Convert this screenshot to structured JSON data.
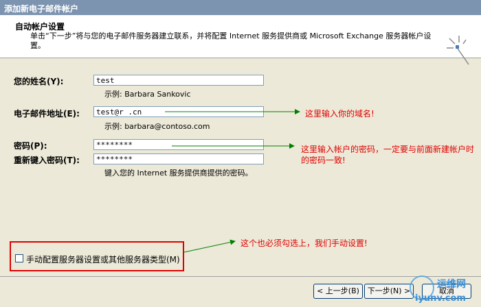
{
  "window": {
    "title": "添加新电子邮件帐户"
  },
  "header": {
    "title": "自动帐户设置",
    "description": "单击“下一步”将与您的电子邮件服务器建立联系，并将配置 Internet 服务提供商或 Microsoft Exchange 服务器帐户设置。"
  },
  "form": {
    "name_label": "您的姓名(Y):",
    "name_value": "test",
    "name_hint": "示例: Barbara Sankovic",
    "email_label": "电子邮件地址(E):",
    "email_value": "test@r      .cn",
    "email_hint": "示例: barbara@contoso.com",
    "password_label": "密码(P):",
    "password_value": "********",
    "retype_label": "重新键入密码(T):",
    "retype_value": "********",
    "password_hint": "键入您的 Internet 服务提供商提供的密码。",
    "manual_label": "手动配置服务器设置或其他服务器类型(M)",
    "manual_checked": false
  },
  "annotations": {
    "domain_note": "这里输入你的域名!",
    "password_note": "这里输入帐户的密码，一定要与前面新建帐户时的密码一致!",
    "manual_note": "这个也必须勾选上，我们手动设置!",
    "color": "#e00000",
    "arrow_color": "#008000"
  },
  "buttons": {
    "back": "< 上一步(B)",
    "next": "下一步(N) >",
    "cancel": "取消"
  },
  "watermark": {
    "name": "运维网",
    "site": "iyunv.com"
  }
}
